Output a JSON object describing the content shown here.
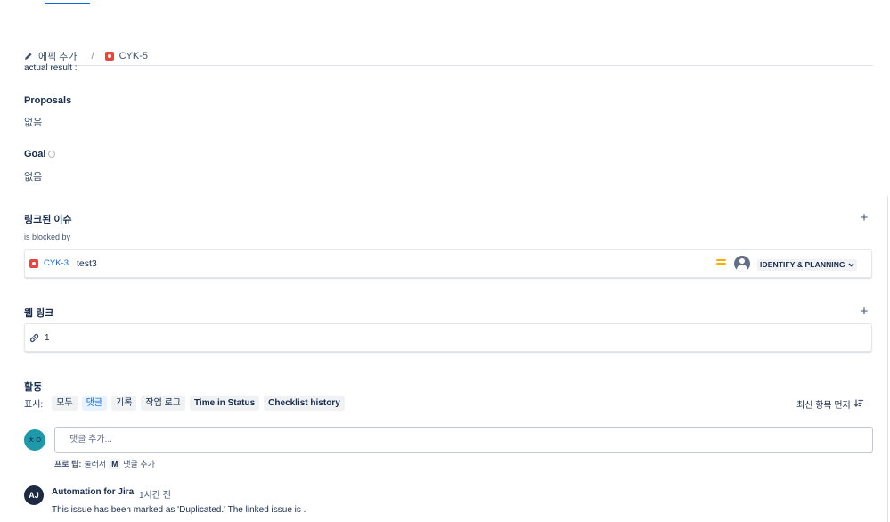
{
  "breadcrumb": {
    "epic_label": "에픽 추가",
    "separator": "/",
    "issue_key": "CYK-5"
  },
  "description": {
    "clipped_text": "actual result :"
  },
  "fields": {
    "proposals": {
      "label": "Proposals",
      "value": "없음"
    },
    "goal": {
      "label": "Goal",
      "value": "없음"
    }
  },
  "linked_issues": {
    "title": "링크된 이슈",
    "relation": "is blocked by",
    "items": [
      {
        "key": "CYK-3",
        "summary": "test3",
        "status": "IDENTIFY & PLANNING"
      }
    ]
  },
  "web_links": {
    "title": "웹 링크",
    "count": "1"
  },
  "activity": {
    "title": "활동",
    "show_label": "표시:",
    "filters": [
      {
        "label": "모두"
      },
      {
        "label": "댓글"
      },
      {
        "label": "기록"
      },
      {
        "label": "작업 로그"
      },
      {
        "label": "Time in Status"
      },
      {
        "label": "Checklist history"
      }
    ],
    "active_filter": "댓글",
    "sort_label": "최신 항목 먼저"
  },
  "comment_box": {
    "avatar_initials": "ㅊㅇ",
    "placeholder": "댓글 추가...",
    "pro_tip_prefix": "프로 팁:",
    "pro_tip_press": "눌러서",
    "pro_tip_key": "M",
    "pro_tip_suffix": "댓글 추가"
  },
  "comments": [
    {
      "avatar_initials": "AJ",
      "author": "Automation for Jira",
      "time": "1시간 전",
      "body": "This issue has been marked as 'Duplicated.' The linked issue is ."
    }
  ],
  "colors": {
    "accent": "#0c66e4",
    "bug_red": "#e2483d",
    "priority_medium": "#ffab00",
    "avatar_teal": "#1d9aaa",
    "avatar_dark": "#1c2b41"
  }
}
